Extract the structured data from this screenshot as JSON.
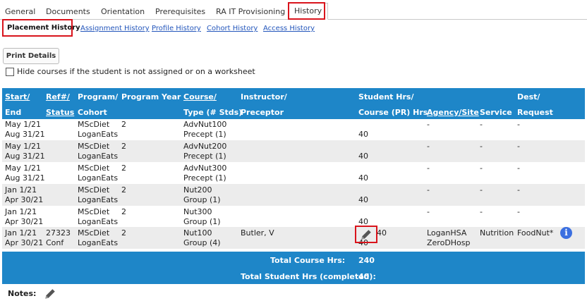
{
  "tabs": [
    "General",
    "Documents",
    "Orientation",
    "Prerequisites",
    "RA IT Provisioning",
    "History"
  ],
  "subtabs": [
    "Placement History",
    "Assignment History",
    "Profile History",
    "Cohort History",
    "Access History"
  ],
  "print_button": "Print Details",
  "hide_checkbox_label": "Hide courses if the student is not assigned or on a worksheet",
  "table": {
    "headers": {
      "start": "Start/",
      "end": "End",
      "ref": "Ref#/",
      "status": "Status",
      "program": "Program/",
      "cohort": "Cohort",
      "year": "Program Year",
      "course": "Course/",
      "type": "Type (# Stds)",
      "instructor": "Instructor/",
      "preceptor": "Preceptor",
      "student_hrs": "Student Hrs/",
      "course_hrs": "Course (PR) Hrs",
      "agency": "Agency/Site",
      "service": "Service",
      "dest": "Dest/",
      "request": "Request"
    },
    "rows": [
      {
        "start": "May 1/21",
        "end": "Aug 31/21",
        "ref": "",
        "status": "",
        "program": "MScDiet",
        "cohort": "LoganEats",
        "year": "2",
        "course": "AdvNut100",
        "type": "Precept (1)",
        "instructor": "",
        "hrs1": "",
        "hrs2": "40",
        "agency1": "-",
        "agency2": "",
        "service": "-",
        "dest": "-",
        "request": ""
      },
      {
        "start": "May 1/21",
        "end": "Aug 31/21",
        "ref": "",
        "status": "",
        "program": "MScDiet",
        "cohort": "LoganEats",
        "year": "2",
        "course": "AdvNut200",
        "type": "Precept (1)",
        "instructor": "",
        "hrs1": "",
        "hrs2": "40",
        "agency1": "-",
        "agency2": "",
        "service": "-",
        "dest": "-",
        "request": ""
      },
      {
        "start": "May 1/21",
        "end": "Aug 31/21",
        "ref": "",
        "status": "",
        "program": "MScDiet",
        "cohort": "LoganEats",
        "year": "2",
        "course": "AdvNut300",
        "type": "Precept (1)",
        "instructor": "",
        "hrs1": "",
        "hrs2": "40",
        "agency1": "-",
        "agency2": "",
        "service": "-",
        "dest": "-",
        "request": ""
      },
      {
        "start": "Jan 1/21",
        "end": "Apr 30/21",
        "ref": "",
        "status": "",
        "program": "MScDiet",
        "cohort": "LoganEats",
        "year": "2",
        "course": "Nut200",
        "type": "Group (1)",
        "instructor": "",
        "hrs1": "",
        "hrs2": "40",
        "agency1": "-",
        "agency2": "",
        "service": "-",
        "dest": "-",
        "request": ""
      },
      {
        "start": "Jan 1/21",
        "end": "Apr 30/21",
        "ref": "",
        "status": "",
        "program": "MScDiet",
        "cohort": "LoganEats",
        "year": "2",
        "course": "Nut300",
        "type": "Group (1)",
        "instructor": "",
        "hrs1": "",
        "hrs2": "40",
        "agency1": "-",
        "agency2": "",
        "service": "-",
        "dest": "-",
        "request": ""
      },
      {
        "start": "Jan 1/21",
        "end": "Apr 30/21",
        "ref": "27323",
        "status": "Conf",
        "program": "MScDiet",
        "cohort": "LoganEats",
        "year": "2",
        "course": "Nut100",
        "type": "Group (4)",
        "instructor": "Butler, V",
        "hrs1": "40",
        "hrs2": "40",
        "agency1": "LoganHSA",
        "agency2": "ZeroDHosp",
        "service": "Nutrition",
        "dest": "FoodNut*",
        "request": ""
      }
    ]
  },
  "totals": {
    "course_label": "Total Course Hrs:",
    "course_value": "240",
    "student_label": "Total Student Hrs (completed):",
    "student_value": "40"
  },
  "notes_label": "Notes:",
  "icons": {
    "edit": "pencil-icon",
    "info": "info-icon",
    "info_glyph": "i"
  },
  "colors": {
    "header_bg": "#1e86c8",
    "link": "#2255bb",
    "highlight": "#d9141c",
    "info": "#3b6fe0"
  }
}
